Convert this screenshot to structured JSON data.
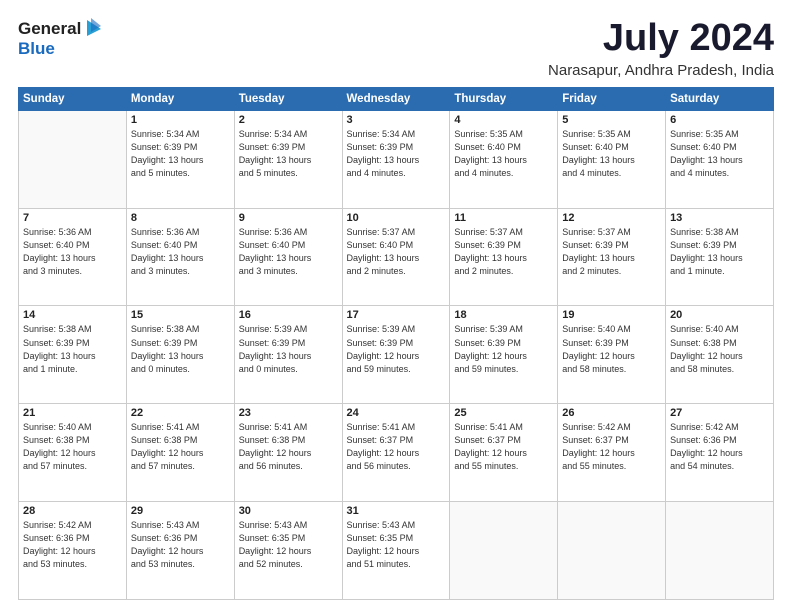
{
  "header": {
    "logo_general": "General",
    "logo_blue": "Blue",
    "month_year": "July 2024",
    "location": "Narasapur, Andhra Pradesh, India"
  },
  "weekdays": [
    "Sunday",
    "Monday",
    "Tuesday",
    "Wednesday",
    "Thursday",
    "Friday",
    "Saturday"
  ],
  "weeks": [
    [
      {
        "day": "",
        "info": ""
      },
      {
        "day": "1",
        "info": "Sunrise: 5:34 AM\nSunset: 6:39 PM\nDaylight: 13 hours\nand 5 minutes."
      },
      {
        "day": "2",
        "info": "Sunrise: 5:34 AM\nSunset: 6:39 PM\nDaylight: 13 hours\nand 5 minutes."
      },
      {
        "day": "3",
        "info": "Sunrise: 5:34 AM\nSunset: 6:39 PM\nDaylight: 13 hours\nand 4 minutes."
      },
      {
        "day": "4",
        "info": "Sunrise: 5:35 AM\nSunset: 6:40 PM\nDaylight: 13 hours\nand 4 minutes."
      },
      {
        "day": "5",
        "info": "Sunrise: 5:35 AM\nSunset: 6:40 PM\nDaylight: 13 hours\nand 4 minutes."
      },
      {
        "day": "6",
        "info": "Sunrise: 5:35 AM\nSunset: 6:40 PM\nDaylight: 13 hours\nand 4 minutes."
      }
    ],
    [
      {
        "day": "7",
        "info": "Sunrise: 5:36 AM\nSunset: 6:40 PM\nDaylight: 13 hours\nand 3 minutes."
      },
      {
        "day": "8",
        "info": "Sunrise: 5:36 AM\nSunset: 6:40 PM\nDaylight: 13 hours\nand 3 minutes."
      },
      {
        "day": "9",
        "info": "Sunrise: 5:36 AM\nSunset: 6:40 PM\nDaylight: 13 hours\nand 3 minutes."
      },
      {
        "day": "10",
        "info": "Sunrise: 5:37 AM\nSunset: 6:40 PM\nDaylight: 13 hours\nand 2 minutes."
      },
      {
        "day": "11",
        "info": "Sunrise: 5:37 AM\nSunset: 6:39 PM\nDaylight: 13 hours\nand 2 minutes."
      },
      {
        "day": "12",
        "info": "Sunrise: 5:37 AM\nSunset: 6:39 PM\nDaylight: 13 hours\nand 2 minutes."
      },
      {
        "day": "13",
        "info": "Sunrise: 5:38 AM\nSunset: 6:39 PM\nDaylight: 13 hours\nand 1 minute."
      }
    ],
    [
      {
        "day": "14",
        "info": "Sunrise: 5:38 AM\nSunset: 6:39 PM\nDaylight: 13 hours\nand 1 minute."
      },
      {
        "day": "15",
        "info": "Sunrise: 5:38 AM\nSunset: 6:39 PM\nDaylight: 13 hours\nand 0 minutes."
      },
      {
        "day": "16",
        "info": "Sunrise: 5:39 AM\nSunset: 6:39 PM\nDaylight: 13 hours\nand 0 minutes."
      },
      {
        "day": "17",
        "info": "Sunrise: 5:39 AM\nSunset: 6:39 PM\nDaylight: 12 hours\nand 59 minutes."
      },
      {
        "day": "18",
        "info": "Sunrise: 5:39 AM\nSunset: 6:39 PM\nDaylight: 12 hours\nand 59 minutes."
      },
      {
        "day": "19",
        "info": "Sunrise: 5:40 AM\nSunset: 6:39 PM\nDaylight: 12 hours\nand 58 minutes."
      },
      {
        "day": "20",
        "info": "Sunrise: 5:40 AM\nSunset: 6:38 PM\nDaylight: 12 hours\nand 58 minutes."
      }
    ],
    [
      {
        "day": "21",
        "info": "Sunrise: 5:40 AM\nSunset: 6:38 PM\nDaylight: 12 hours\nand 57 minutes."
      },
      {
        "day": "22",
        "info": "Sunrise: 5:41 AM\nSunset: 6:38 PM\nDaylight: 12 hours\nand 57 minutes."
      },
      {
        "day": "23",
        "info": "Sunrise: 5:41 AM\nSunset: 6:38 PM\nDaylight: 12 hours\nand 56 minutes."
      },
      {
        "day": "24",
        "info": "Sunrise: 5:41 AM\nSunset: 6:37 PM\nDaylight: 12 hours\nand 56 minutes."
      },
      {
        "day": "25",
        "info": "Sunrise: 5:41 AM\nSunset: 6:37 PM\nDaylight: 12 hours\nand 55 minutes."
      },
      {
        "day": "26",
        "info": "Sunrise: 5:42 AM\nSunset: 6:37 PM\nDaylight: 12 hours\nand 55 minutes."
      },
      {
        "day": "27",
        "info": "Sunrise: 5:42 AM\nSunset: 6:36 PM\nDaylight: 12 hours\nand 54 minutes."
      }
    ],
    [
      {
        "day": "28",
        "info": "Sunrise: 5:42 AM\nSunset: 6:36 PM\nDaylight: 12 hours\nand 53 minutes."
      },
      {
        "day": "29",
        "info": "Sunrise: 5:43 AM\nSunset: 6:36 PM\nDaylight: 12 hours\nand 53 minutes."
      },
      {
        "day": "30",
        "info": "Sunrise: 5:43 AM\nSunset: 6:35 PM\nDaylight: 12 hours\nand 52 minutes."
      },
      {
        "day": "31",
        "info": "Sunrise: 5:43 AM\nSunset: 6:35 PM\nDaylight: 12 hours\nand 51 minutes."
      },
      {
        "day": "",
        "info": ""
      },
      {
        "day": "",
        "info": ""
      },
      {
        "day": "",
        "info": ""
      }
    ]
  ]
}
